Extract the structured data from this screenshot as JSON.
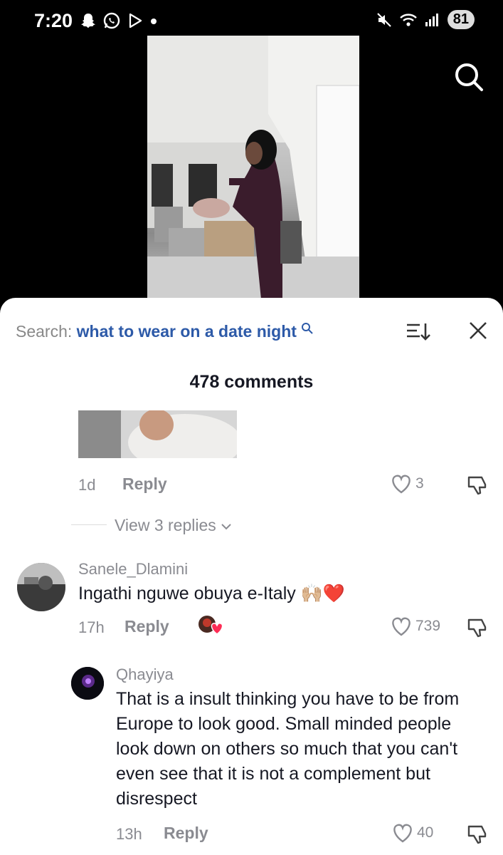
{
  "status_bar": {
    "time": "7:20",
    "battery": "81",
    "left_icons": [
      "snapchat-icon",
      "whatsapp-icon",
      "play-icon",
      "dot-icon"
    ],
    "right_icons": [
      "mute-icon",
      "wifi-icon",
      "signal-icon"
    ]
  },
  "sheet": {
    "search_label": "Search:",
    "search_query": "what to wear on a date night",
    "comments_count": "478 comments"
  },
  "comment1": {
    "age": "1d",
    "reply_label": "Reply",
    "likes": "3"
  },
  "view_replies": "View 3 replies",
  "comment2": {
    "username": "Sanele_Dlamini",
    "text": "Ingathi nguwe obuya e-Italy 🙌🏼❤️",
    "age": "17h",
    "reply_label": "Reply",
    "likes": "739"
  },
  "comment3": {
    "username": "Qhayiya",
    "text": "That is a insult thinking you have to be from Europe to look good. Small minded people look down on others so much that you can't even see that it is not a complement but disrespect",
    "age": "13h",
    "reply_label": "Reply",
    "likes": "40"
  }
}
